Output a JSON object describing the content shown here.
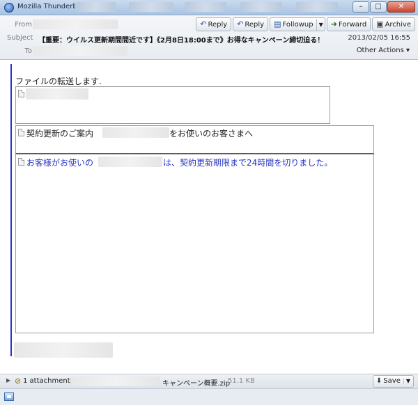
{
  "window": {
    "title": "Mozilla Thunderbird",
    "minimize": "–",
    "maximize": "□",
    "close": "✕"
  },
  "header": {
    "from_label": "From",
    "subject_label": "Subject",
    "to_label": "To",
    "subject": "【重要：ウイルス更新期間間近です】《2月8日18:00まで》お得なキャンペーン締切迫る！",
    "date": "2013/02/05 16:55",
    "other_actions": "Other Actions ▾",
    "buttons": {
      "reply": "Reply",
      "reply2": "Reply",
      "followup": "Followup",
      "forward": "Forward",
      "archive": "Archive"
    }
  },
  "body": {
    "intro": "ファイルの転送します.",
    "frame2_text_a": "契約更新のご案内",
    "frame2_text_b": "をお使いのお客さまへ",
    "frame3_text_a": "お客様がお使いの",
    "frame3_text_b": "は、契約更新期限まで24時間を切りました。"
  },
  "attachment": {
    "label": "1 attachment:",
    "name": "キャンペーン概要.zip",
    "size": "51.1 KB",
    "save": "Save"
  },
  "colors": {
    "link_blue": "#2433c0",
    "quote_bar": "#2b33c9"
  }
}
